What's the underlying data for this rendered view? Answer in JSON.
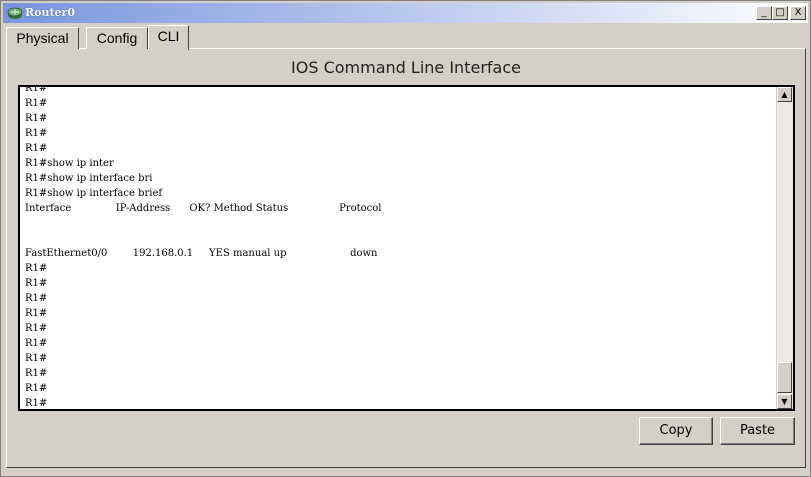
{
  "window": {
    "title": "Router0",
    "minimize_glyph": "_",
    "maximize_glyph": "□",
    "close_glyph": "X",
    "icon": "router-icon"
  },
  "tabs": [
    {
      "label": "Physical",
      "active": false
    },
    {
      "label": "Config",
      "active": false
    },
    {
      "label": "CLI",
      "active": true
    }
  ],
  "panel": {
    "title": "IOS Command Line Interface"
  },
  "terminal": {
    "lines": [
      "R1#",
      "R1#",
      "R1#",
      "R1#",
      "R1#",
      "R1#show ip inter",
      "R1#show ip interface bri",
      "R1#show ip interface brief",
      "Interface              IP-Address      OK? Method Status                Protocol",
      "",
      "",
      "FastEthernet0/0        192.168.0.1     YES manual up                    down",
      "R1#",
      "R1#",
      "R1#",
      "R1#",
      "R1#",
      "R1#",
      "R1#",
      "R1#",
      "R1#",
      "R1#"
    ]
  },
  "scrollbar": {
    "up_glyph": "▲",
    "down_glyph": "▼"
  },
  "buttons": {
    "copy": "Copy",
    "paste": "Paste"
  }
}
